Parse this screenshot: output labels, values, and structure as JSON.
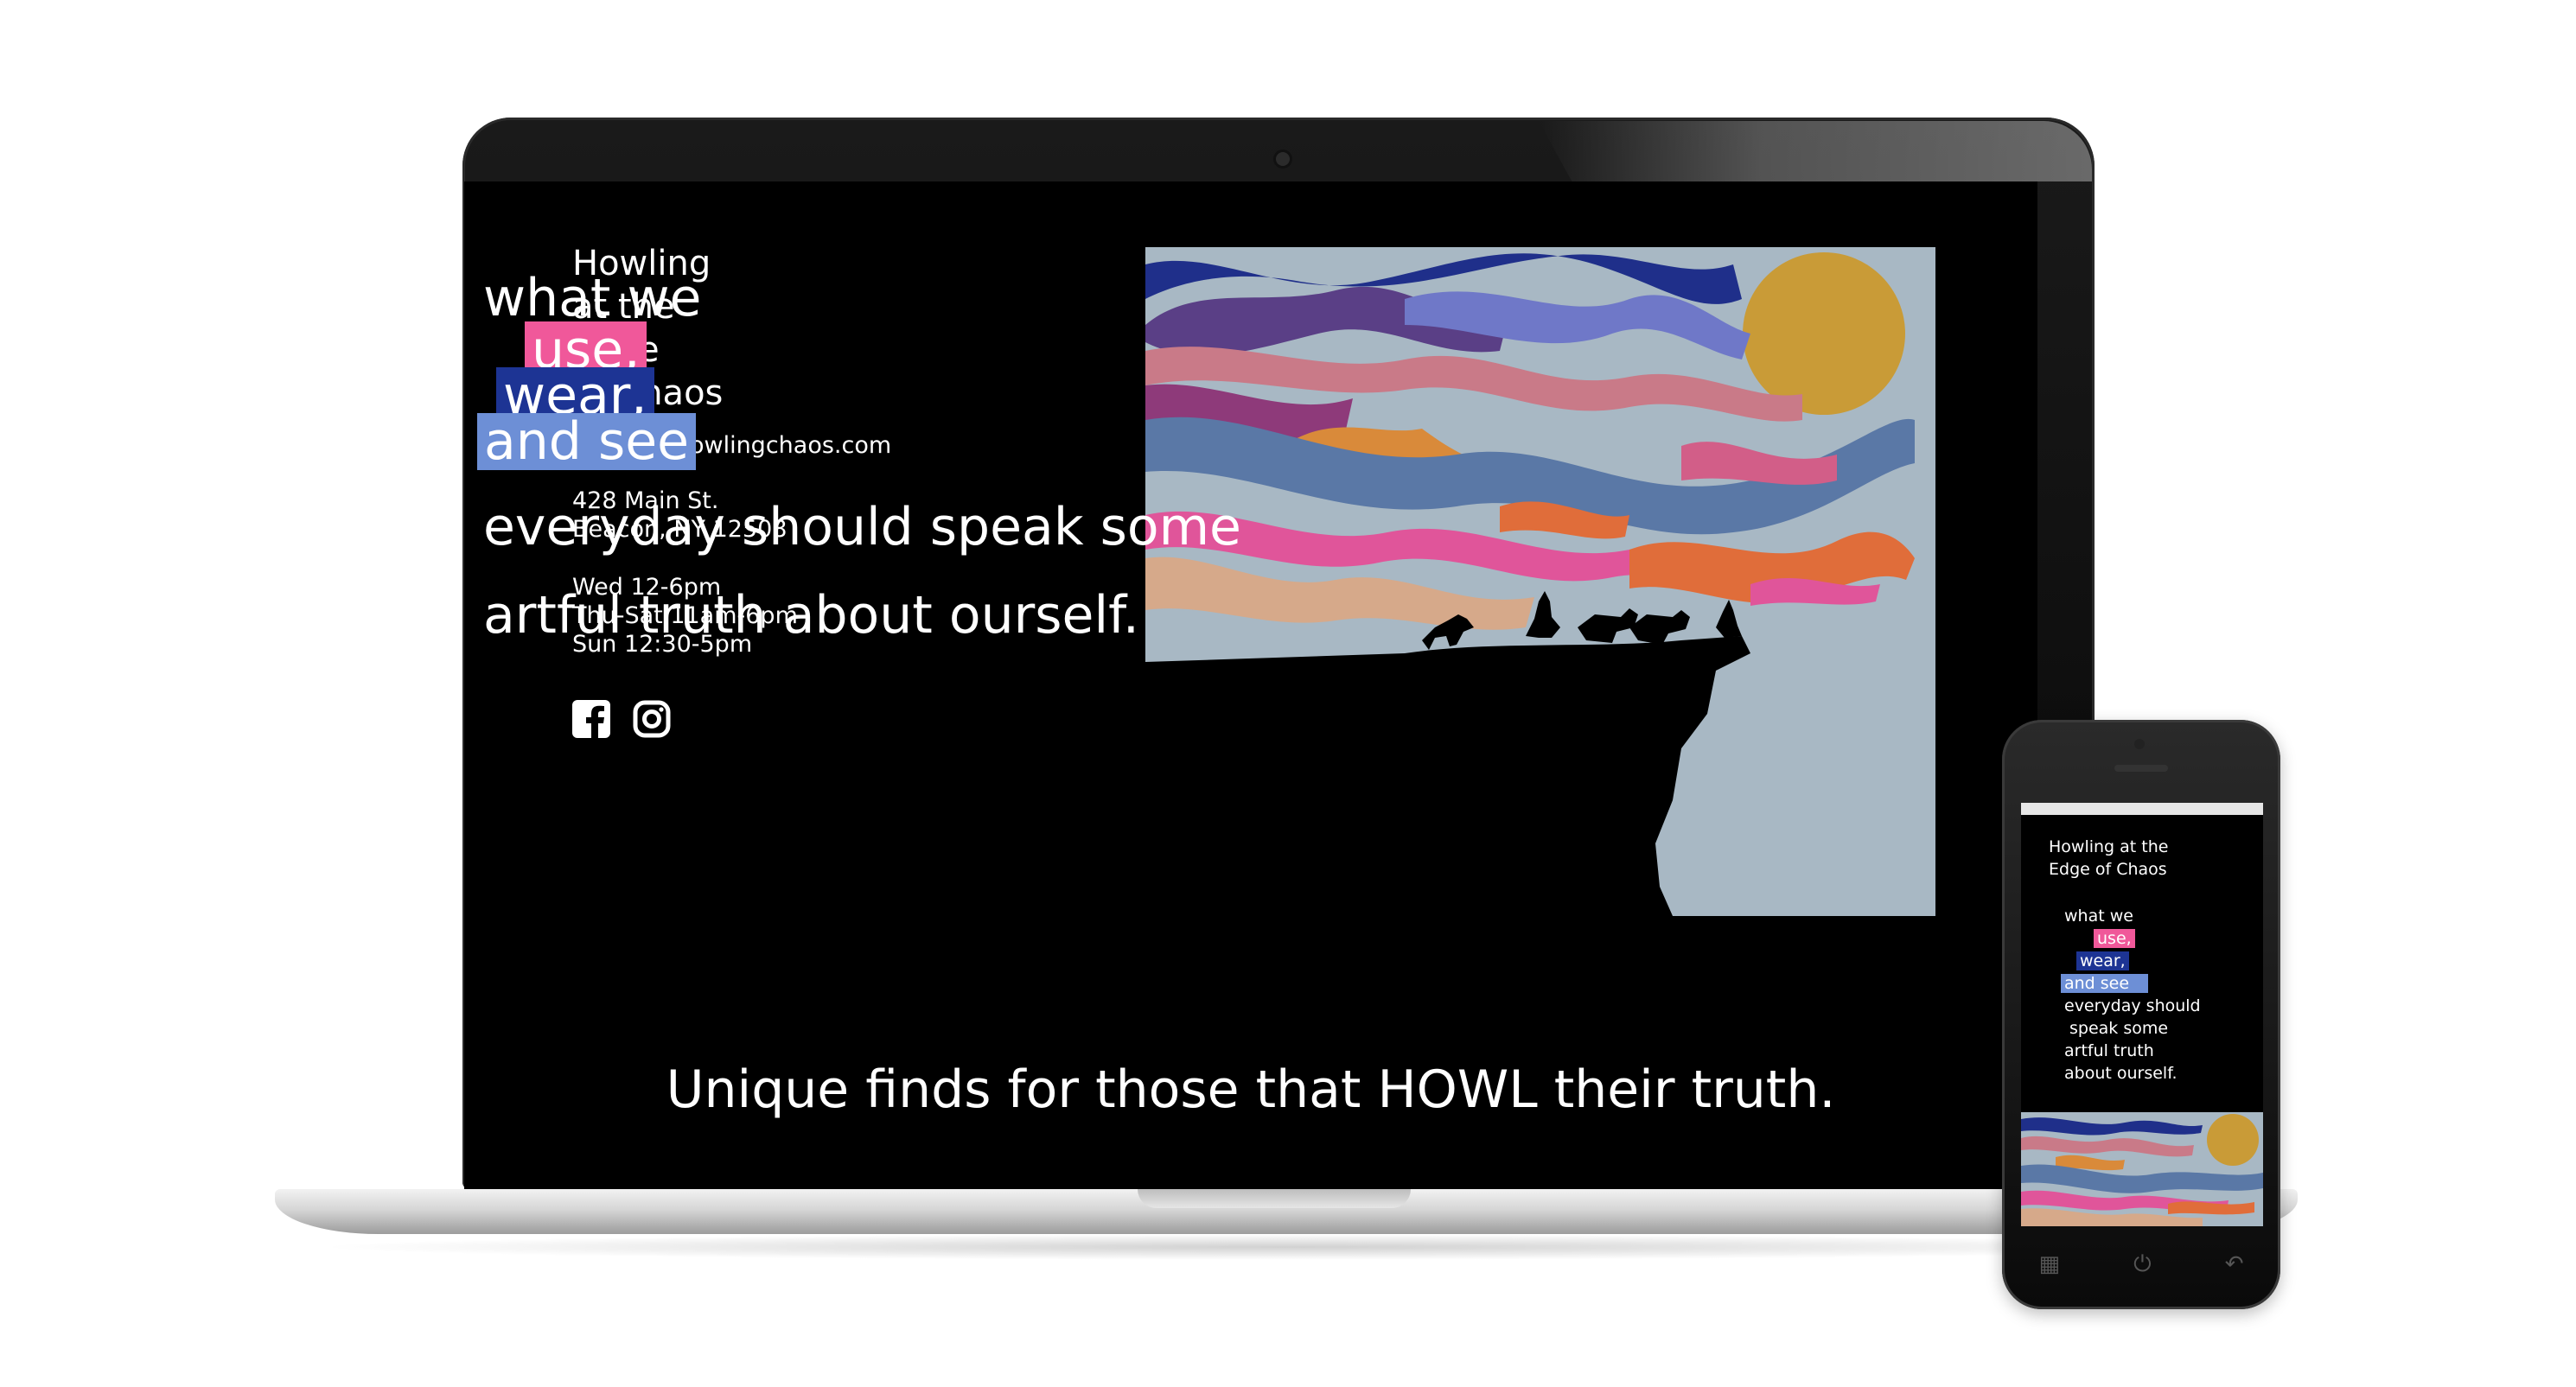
{
  "laptop_site": {
    "title_lines": [
      "Howling",
      "at the",
      "Edge",
      "of Chaos"
    ],
    "email": "valerie@howlingchaos.com",
    "address": [
      "428 Main St.",
      "Beacon, NY 12508"
    ],
    "hours": [
      "Wed 12-6pm",
      "Thu-Sat 11am-6pm",
      "Sun 12:30-5pm"
    ],
    "social_icons": [
      "facebook-icon",
      "instagram-icon"
    ],
    "hero": {
      "line1": "what we",
      "line2": "use,",
      "line3": "wear,",
      "line4": "and see",
      "line5": "everyday should speak some",
      "line6": "artful truth about ourself."
    },
    "tagline": "Unique finds for those that HOWL their truth."
  },
  "mobile_site": {
    "title_lines": [
      "Howling at the",
      "Edge of Chaos"
    ],
    "hero_lines": [
      "what we",
      "use,",
      "wear,",
      "and see",
      "everyday should",
      "speak some",
      "artful truth",
      "about ourself."
    ]
  },
  "colors": {
    "background": "#000000",
    "text": "#ffffff",
    "highlight_pink": "#f0589a",
    "highlight_navy": "#1d3494",
    "highlight_lightblue": "#6d8fd6",
    "art_sky": "#a8b8c4",
    "art_sun": "#c99b37"
  }
}
